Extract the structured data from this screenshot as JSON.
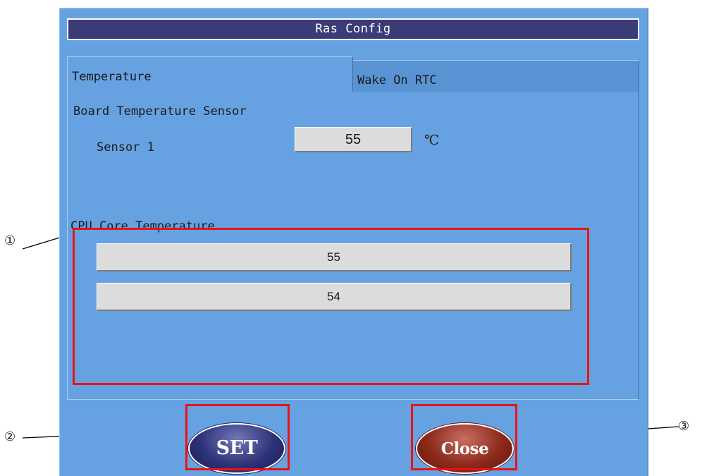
{
  "window": {
    "title": "Ras Config"
  },
  "tabs": [
    {
      "label": "Temperature",
      "active": true
    },
    {
      "label": "Wake On RTC",
      "active": false
    }
  ],
  "board": {
    "section_label": "Board Temperature Sensor",
    "sensor_label": "Sensor 1",
    "sensor_value": "55",
    "unit": "℃"
  },
  "cpu": {
    "section_label": "CPU Core Temperature",
    "cores": [
      "55",
      "54"
    ]
  },
  "buttons": {
    "set_label": "SET",
    "close_label": "Close"
  },
  "callouts": {
    "c1": "①",
    "c2": "②",
    "c3": "③"
  },
  "colors": {
    "window_bg": "#66a2e2",
    "title_bg": "#3b3b78",
    "highlight": "#ee1111",
    "set_button": "#2e3278",
    "close_button": "#8c2a1c"
  }
}
